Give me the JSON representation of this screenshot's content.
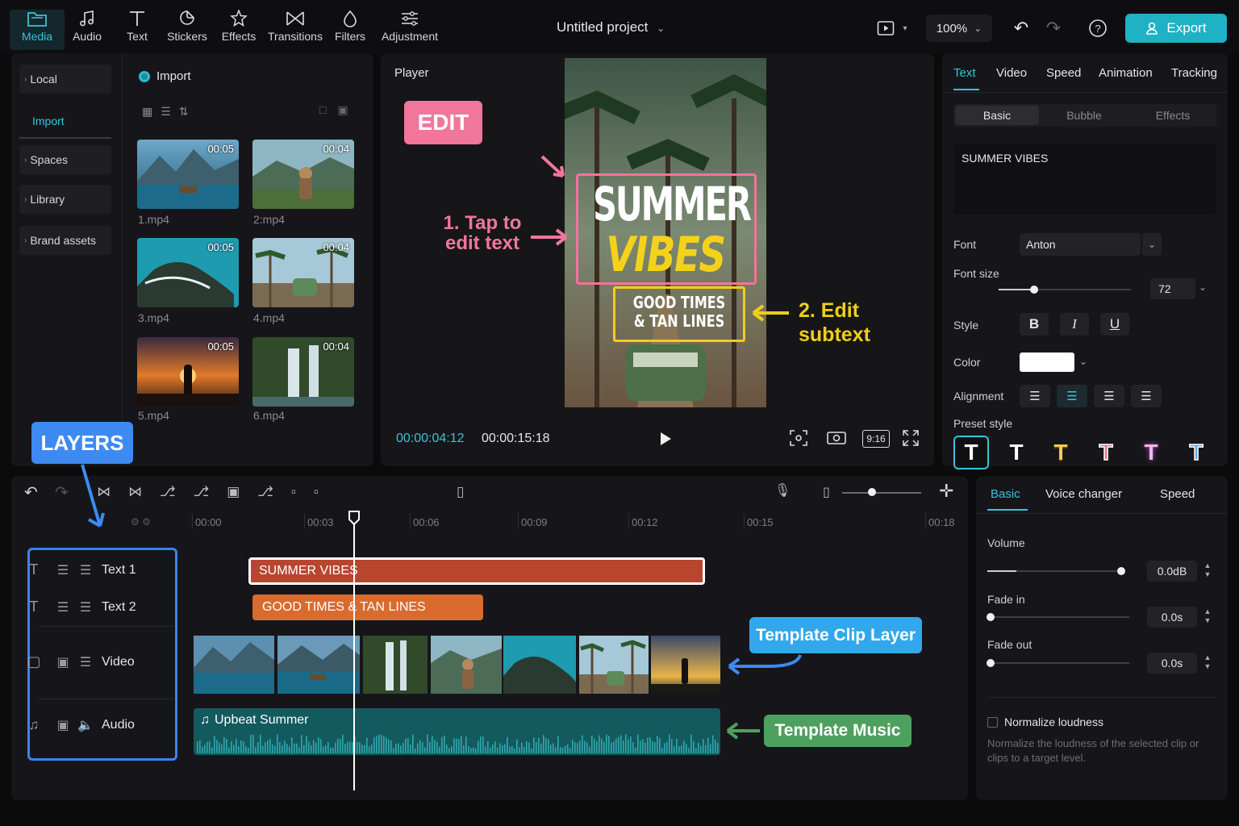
{
  "toolbar": {
    "tools": [
      {
        "label": "Media",
        "icon": "folder-icon"
      },
      {
        "label": "Audio",
        "icon": "music-note-icon"
      },
      {
        "label": "Text",
        "icon": "text-t-icon"
      },
      {
        "label": "Stickers",
        "icon": "sticker-icon"
      },
      {
        "label": "Effects",
        "icon": "sparkle-icon"
      },
      {
        "label": "Transitions",
        "icon": "transition-icon"
      },
      {
        "label": "Filters",
        "icon": "filter-drop-icon"
      },
      {
        "label": "Adjustment",
        "icon": "sliders-icon"
      }
    ],
    "project_title": "Untitled project",
    "zoom": "100%",
    "export_label": "Export",
    "accent": "#1fb1c4"
  },
  "media": {
    "sidebar": [
      "Local",
      "Import",
      "Spaces",
      "Library",
      "Brand assets"
    ],
    "import_label": "Import",
    "items": [
      {
        "name": "1.mp4",
        "duration": "00:05"
      },
      {
        "name": "2:mp4",
        "duration": "00:04"
      },
      {
        "name": "3.mp4",
        "duration": "00:05"
      },
      {
        "name": "4.mp4",
        "duration": "00:04"
      },
      {
        "name": "5.mp4",
        "duration": "00:05"
      },
      {
        "name": "6.mp4",
        "duration": "00:04"
      }
    ]
  },
  "player": {
    "title": "Player",
    "headline": "SUMMER",
    "headline2": "VIBES",
    "subtext_line1": "GOOD TIMES",
    "subtext_line2": "& TAN LINES",
    "current_time": "00:00:04:12",
    "total_time": "00:00:15:18",
    "aspect": "9:16"
  },
  "annotations": {
    "edit": "EDIT",
    "tap1": "1. Tap to",
    "tap2": "edit text",
    "sub1": "2. Edit",
    "sub2": "subtext",
    "layers": "LAYERS",
    "clip_layer": "Template Clip Layer",
    "music": "Template Music"
  },
  "props": {
    "tabs": [
      "Text",
      "Video",
      "Speed",
      "Animation",
      "Tracking"
    ],
    "subtabs": [
      "Basic",
      "Bubble",
      "Effects"
    ],
    "text_value": "SUMMER VIBES",
    "font_label": "Font",
    "font_value": "Anton",
    "font_size_label": "Font size",
    "font_size_value": "72",
    "font_size_level": 0.27,
    "style_label": "Style",
    "style_buttons": [
      "B",
      "I",
      "U"
    ],
    "color_label": "Color",
    "alignment_label": "Alignment",
    "preset_label": "Preset style",
    "preset_glyph": "T"
  },
  "timeline": {
    "ruler": [
      "00:00",
      "00:03",
      "00:06",
      "00:09",
      "00:12",
      "00:15",
      "00:18"
    ],
    "layers": [
      "Text 1",
      "Text 2",
      "Video",
      "Audio"
    ],
    "clip_text1": "SUMMER VIBES",
    "clip_text2": "GOOD TIMES & TAN LINES",
    "clip_audio": "Upbeat Summer",
    "zoom_level": 0.38
  },
  "audio": {
    "tabs": [
      "Basic",
      "Voice changer",
      "Speed"
    ],
    "volume_label": "Volume",
    "volume_value": "0.0dB",
    "volume_level": 1.0,
    "fade_in_label": "Fade in",
    "fade_in_value": "0.0s",
    "fade_out_label": "Fade out",
    "fade_out_value": "0.0s",
    "normalize_label": "Normalize loudness",
    "normalize_desc": "Normalize the loudness of the selected clip or clips to a target level."
  }
}
